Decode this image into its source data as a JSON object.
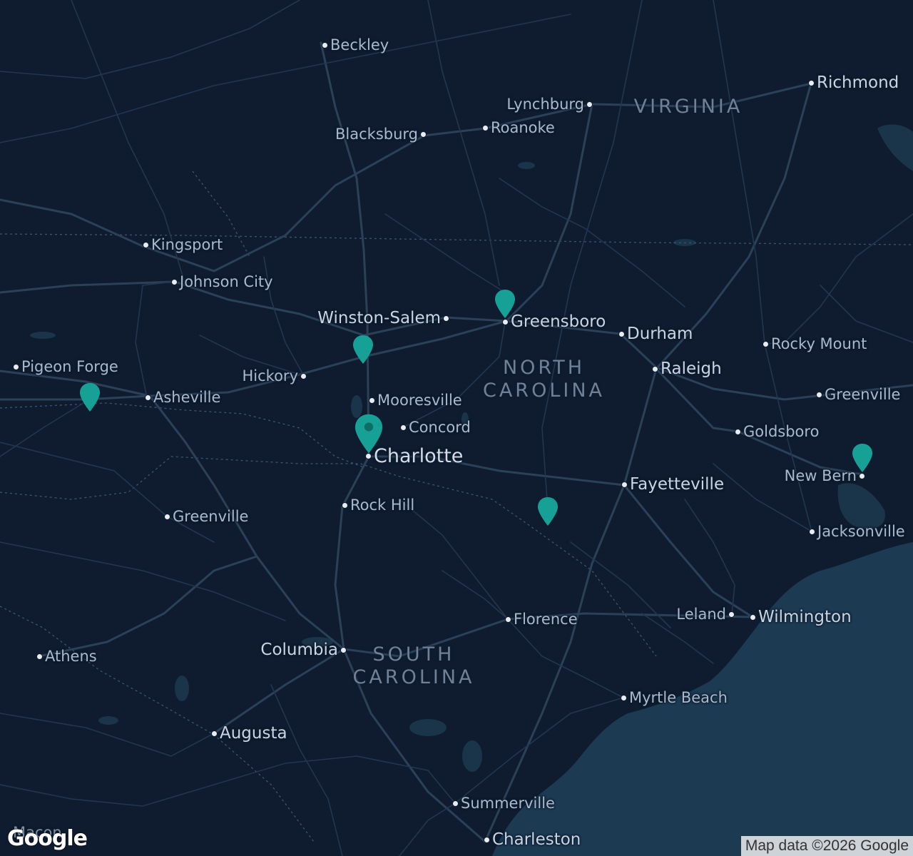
{
  "map": {
    "provider_logo": "Google",
    "attribution": "Map data ©2026 Google",
    "theme_colors": {
      "land": "#0f1c2f",
      "water": "#1c3a52",
      "roads": "#2a4158",
      "labels": "#aab9cc",
      "states": "#6f8197",
      "marker": "#17a096"
    },
    "states": [
      {
        "id": "virginia",
        "lines": [
          "VIRGINIA"
        ]
      },
      {
        "id": "north-carolina",
        "lines": [
          "NORTH",
          "CAROLINA"
        ]
      },
      {
        "id": "south-carolina",
        "lines": [
          "SOUTH",
          "CAROLINA"
        ]
      }
    ],
    "cities": [
      {
        "id": "beckley",
        "name": "Beckley"
      },
      {
        "id": "richmond",
        "name": "Richmond"
      },
      {
        "id": "lynchburg",
        "name": "Lynchburg"
      },
      {
        "id": "roanoke",
        "name": "Roanoke"
      },
      {
        "id": "blacksburg",
        "name": "Blacksburg"
      },
      {
        "id": "kingsport",
        "name": "Kingsport"
      },
      {
        "id": "johnson-city",
        "name": "Johnson City"
      },
      {
        "id": "winston-salem",
        "name": "Winston-Salem"
      },
      {
        "id": "greensboro",
        "name": "Greensboro"
      },
      {
        "id": "durham",
        "name": "Durham"
      },
      {
        "id": "rocky-mount",
        "name": "Rocky Mount"
      },
      {
        "id": "raleigh",
        "name": "Raleigh"
      },
      {
        "id": "pigeon-forge",
        "name": "Pigeon Forge"
      },
      {
        "id": "hickory",
        "name": "Hickory"
      },
      {
        "id": "asheville",
        "name": "Asheville"
      },
      {
        "id": "mooresville",
        "name": "Mooresville"
      },
      {
        "id": "greenville-nc",
        "name": "Greenville"
      },
      {
        "id": "concord",
        "name": "Concord"
      },
      {
        "id": "goldsboro",
        "name": "Goldsboro"
      },
      {
        "id": "charlotte",
        "name": "Charlotte"
      },
      {
        "id": "new-bern",
        "name": "New Bern"
      },
      {
        "id": "fayetteville",
        "name": "Fayetteville"
      },
      {
        "id": "rock-hill",
        "name": "Rock Hill"
      },
      {
        "id": "greenville-sc",
        "name": "Greenville"
      },
      {
        "id": "jacksonville",
        "name": "Jacksonville"
      },
      {
        "id": "florence",
        "name": "Florence"
      },
      {
        "id": "leland",
        "name": "Leland"
      },
      {
        "id": "wilmington",
        "name": "Wilmington"
      },
      {
        "id": "athens",
        "name": "Athens"
      },
      {
        "id": "columbia",
        "name": "Columbia"
      },
      {
        "id": "myrtle-beach",
        "name": "Myrtle Beach"
      },
      {
        "id": "augusta",
        "name": "Augusta"
      },
      {
        "id": "summerville",
        "name": "Summerville"
      },
      {
        "id": "charleston",
        "name": "Charleston"
      },
      {
        "id": "macon",
        "name": "Macon"
      }
    ],
    "markers": [
      {
        "id": "greensboro-marker"
      },
      {
        "id": "winston-salem-marker"
      },
      {
        "id": "pigeon-forge-marker"
      },
      {
        "id": "charlotte-marker",
        "selected": true
      },
      {
        "id": "pinehurst-area-marker"
      },
      {
        "id": "new-bern-marker"
      }
    ]
  }
}
